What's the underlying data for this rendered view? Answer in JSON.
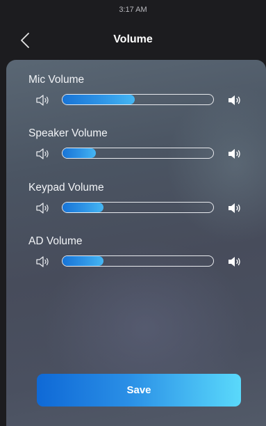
{
  "status_bar": {
    "time": "3:17 AM"
  },
  "header": {
    "title": "Volume",
    "back_icon": "chevron-left-icon"
  },
  "volumes": [
    {
      "label": "Mic Volume",
      "level": 0.48
    },
    {
      "label": "Speaker Volume",
      "level": 0.22
    },
    {
      "label": "Keypad Volume",
      "level": 0.27
    },
    {
      "label": "AD Volume",
      "level": 0.27
    }
  ],
  "icons": {
    "low": "speaker-low-icon",
    "high": "speaker-high-icon"
  },
  "save_label": "Save",
  "colors": {
    "accent": "#1874d6",
    "accent_light": "#5ad9fb",
    "header_bg": "#1c1c1f",
    "text": "#ffffff"
  }
}
